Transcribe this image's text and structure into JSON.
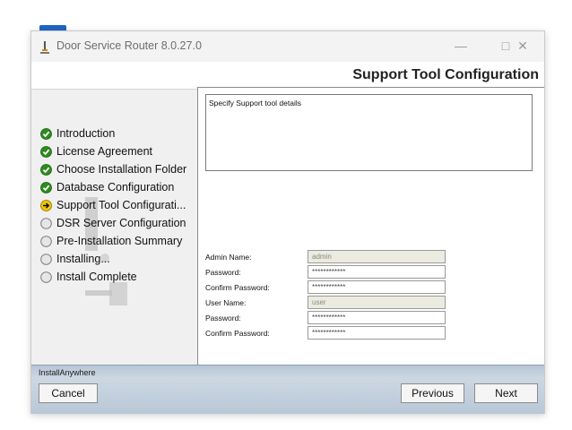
{
  "window": {
    "title": "Door Service Router 8.0.27.0",
    "controls": {
      "minimize": "—",
      "maximize": "□",
      "close": "✕"
    }
  },
  "header": {
    "title": "Support Tool Configuration"
  },
  "steps": [
    {
      "label": "Introduction",
      "status": "complete"
    },
    {
      "label": "License Agreement",
      "status": "complete"
    },
    {
      "label": "Choose Installation Folder",
      "status": "complete"
    },
    {
      "label": "Database Configuration",
      "status": "complete"
    },
    {
      "label": "Support Tool Configurati...",
      "status": "current"
    },
    {
      "label": "DSR Server Configuration",
      "status": "pending"
    },
    {
      "label": "Pre-Installation Summary",
      "status": "pending"
    },
    {
      "label": "Installing...",
      "status": "pending"
    },
    {
      "label": "Install Complete",
      "status": "pending"
    }
  ],
  "description": "Specify Support tool details",
  "form": {
    "admin_name": {
      "label": "Admin Name:",
      "value": "admin"
    },
    "admin_password": {
      "label": "Password:",
      "value": "************"
    },
    "admin_confirm": {
      "label": "Confirm Password:",
      "value": "************"
    },
    "user_name": {
      "label": "User Name:",
      "value": "user"
    },
    "user_password": {
      "label": "Password:",
      "value": "************"
    },
    "user_confirm": {
      "label": "Confirm Password:",
      "value": "************"
    }
  },
  "footer": {
    "brand": "InstallAnywhere",
    "cancel": "Cancel",
    "previous": "Previous",
    "next": "Next"
  },
  "colors": {
    "complete": "#2e8b1e",
    "current": "#e0b400",
    "accent": "#1f66c2"
  }
}
